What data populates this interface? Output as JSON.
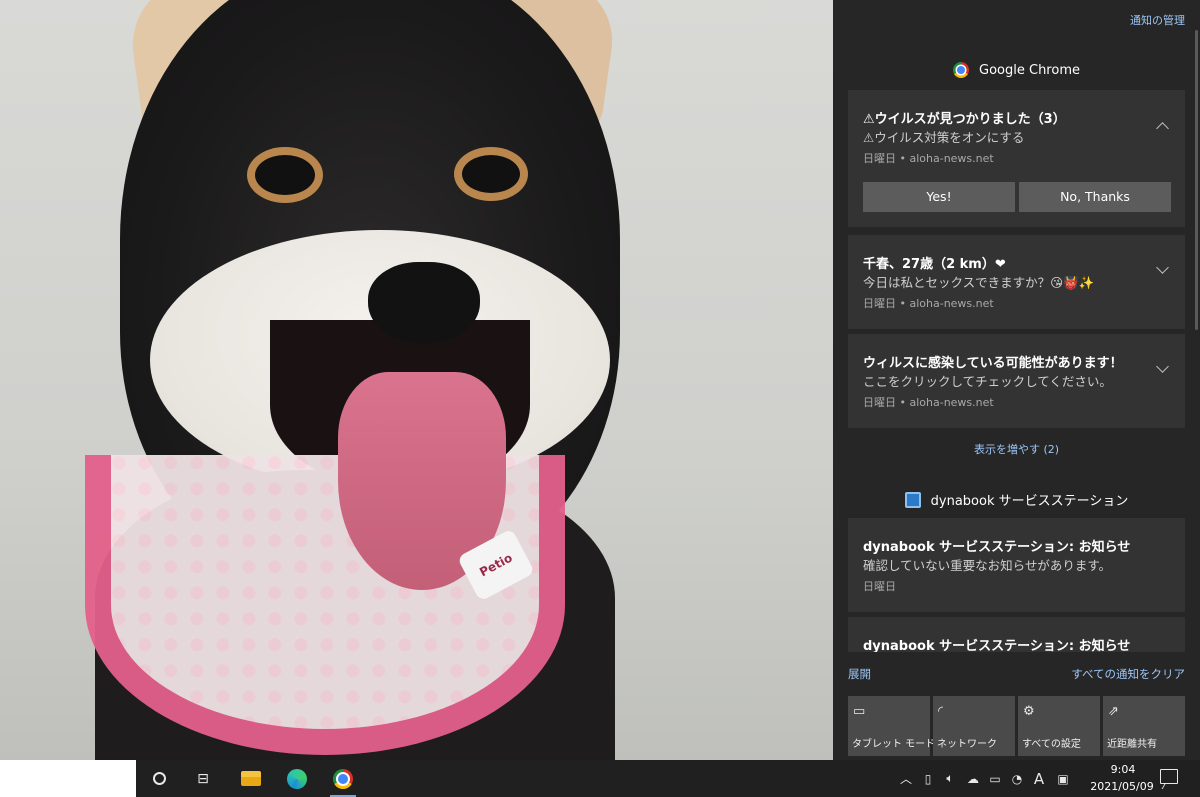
{
  "wallpaper": {
    "harness_tag_text": "Petio"
  },
  "action_center": {
    "manage_notifications": "通知の管理",
    "groups": [
      {
        "app_name": "Google Chrome",
        "notifications": [
          {
            "title": "⚠ウイルスが見つかりました（3）",
            "body": "⚠ウイルス対策をオンにする",
            "meta": "日曜日 • aloha-news.net",
            "expanded": true,
            "buttons": [
              "Yes!",
              "No, Thanks"
            ]
          },
          {
            "title": "千春、27歳（2 km）❤",
            "body": "今日は私とセックスできますか？😘👹✨",
            "meta": "日曜日 • aloha-news.net",
            "expanded": false
          },
          {
            "title": "ウィルスに感染している可能性があります！",
            "body": "ここをクリックしてチェックしてください。",
            "meta": "日曜日 • aloha-news.net",
            "expanded": false
          }
        ],
        "show_more": "表示を増やす (2)"
      },
      {
        "app_name": "dynabook サービスステーション",
        "notifications": [
          {
            "title": "dynabook サービスステーション: お知らせ",
            "body": "確認していない重要なお知らせがあります。",
            "meta": "日曜日"
          },
          {
            "title": "dynabook サービスステーション: お知らせ",
            "body": "",
            "meta": ""
          }
        ]
      }
    ],
    "expand": "展開",
    "clear_all": "すべての通知をクリア",
    "quick_actions": [
      {
        "label": "タブレット モード",
        "icon": "tablet-mode-icon"
      },
      {
        "label": "ネットワーク",
        "icon": "network-icon"
      },
      {
        "label": "すべての設定",
        "icon": "settings-gear-icon"
      },
      {
        "label": "近距離共有",
        "icon": "nearby-share-icon"
      }
    ]
  },
  "taskbar": {
    "pinned": [
      "cortana-icon",
      "task-view-icon",
      "file-explorer-icon",
      "edge-icon",
      "chrome-icon"
    ],
    "tray": {
      "ime_indicator": "A",
      "time": "9:04",
      "date": "2021/05/09"
    }
  },
  "colors": {
    "panel_bg": "#262626",
    "toast_bg": "#333333",
    "link_blue": "#9cc6f5",
    "taskbar_bg": "#202020"
  }
}
